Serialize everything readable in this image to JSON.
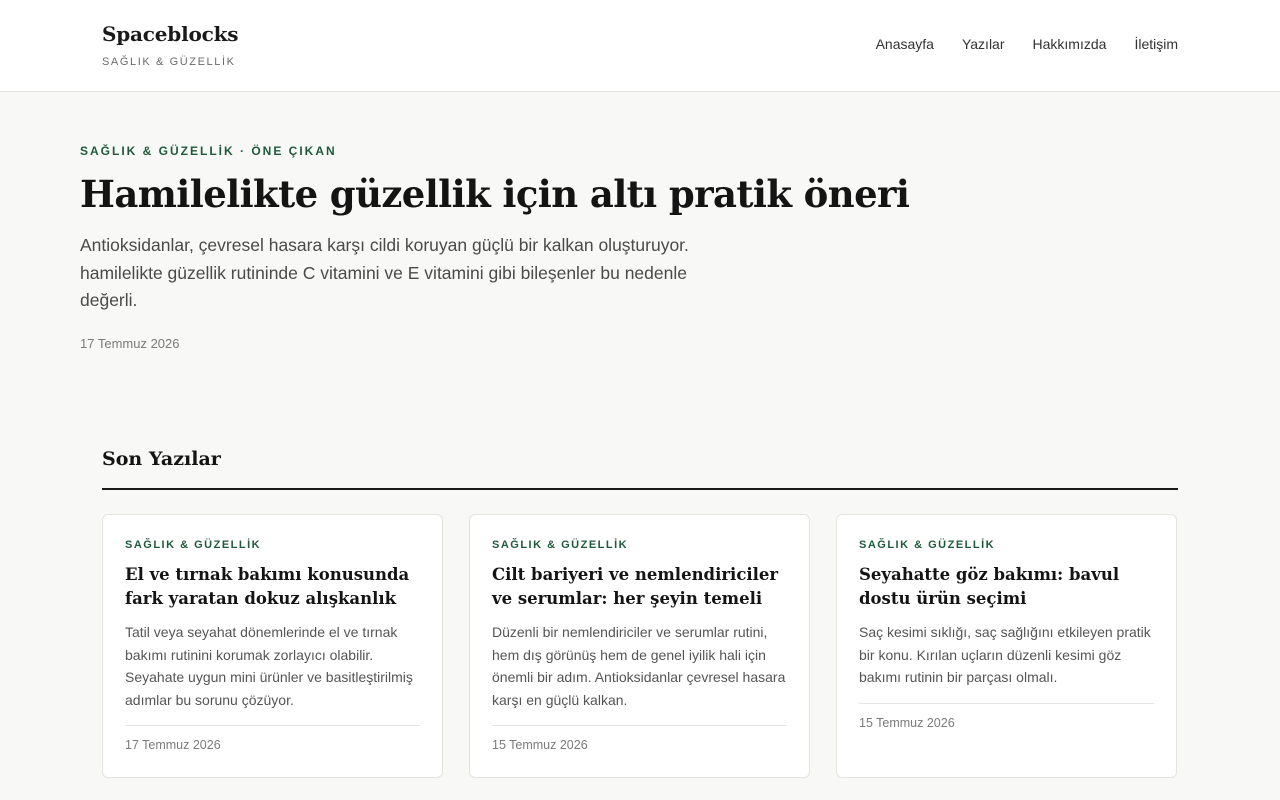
{
  "site": {
    "name": "Spaceblocks",
    "tagline": "SAĞLIK & GÜZELLİK"
  },
  "nav": {
    "items": [
      {
        "label": "Anasayfa"
      },
      {
        "label": "Yazılar"
      },
      {
        "label": "Hakkımızda"
      },
      {
        "label": "İletişim"
      }
    ]
  },
  "hero": {
    "kicker": "SAĞLIK & GÜZELLİK · ÖNE ÇIKAN",
    "title": "Hamilelikte güzellik için altı pratik öneri",
    "lede": "Antioksidanlar, çevresel hasara karşı cildi koruyan güçlü bir kalkan oluşturuyor. hamilelikte güzellik rutininde C vitamini ve E vitamini gibi bileşenler bu nedenle değerli.",
    "date": "17 Temmuz 2026"
  },
  "recent": {
    "heading": "Son Yazılar",
    "posts": [
      {
        "kicker": "SAĞLIK & GÜZELLİK",
        "title": "El ve tırnak bakımı konusunda fark yaratan dokuz alışkanlık",
        "excerpt": "Tatil veya seyahat dönemlerinde el ve tırnak bakımı rutinini korumak zorlayıcı olabilir. Seyahate uygun mini ürünler ve basitleştirilmiş adımlar bu sorunu çözüyor.",
        "date": "17 Temmuz 2026"
      },
      {
        "kicker": "SAĞLIK & GÜZELLİK",
        "title": "Cilt bariyeri ve nemlendiriciler ve serumlar: her şeyin temeli",
        "excerpt": "Düzenli bir nemlendiriciler ve serumlar rutini, hem dış görünüş hem de genel iyilik hali için önemli bir adım. Antioksidanlar çevresel hasara karşı en güçlü kalkan.",
        "date": "15 Temmuz 2026"
      },
      {
        "kicker": "SAĞLIK & GÜZELLİK",
        "title": "Seyahatte göz bakımı: bavul dostu ürün seçimi",
        "excerpt": "Saç kesimi sıklığı, saç sağlığını etkileyen pratik bir konu. Kırılan uçların düzenli kesimi göz bakımı rutinin bir parçası olmalı.",
        "date": "15 Temmuz 2026"
      }
    ]
  },
  "colors": {
    "accent": "#1f5a3c",
    "page_background": "#f8f8f6",
    "header_background": "#ffffff"
  }
}
